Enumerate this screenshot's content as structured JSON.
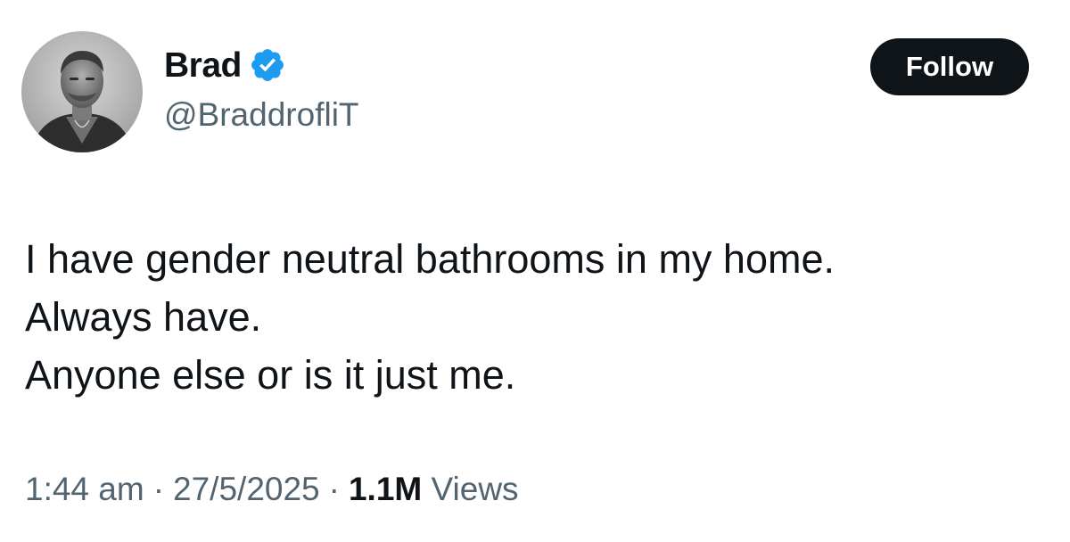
{
  "author": {
    "display_name": "Brad",
    "handle": "@BraddrofliT",
    "verified": true,
    "verified_icon": "verified-badge-icon",
    "avatar_icon": "profile-photo"
  },
  "follow_button": {
    "label": "Follow"
  },
  "tweet": {
    "lines": [
      "I have gender neutral bathrooms in my home.",
      "Always have.",
      "Anyone else or is it just me."
    ]
  },
  "meta": {
    "time": "1:44 am",
    "separator": "·",
    "date": "27/5/2025",
    "views_count": "1.1M",
    "views_label": "Views"
  },
  "colors": {
    "text_primary": "#0f1419",
    "text_secondary": "#536471",
    "verified_blue": "#1d9bf0",
    "follow_bg": "#0f1419"
  }
}
